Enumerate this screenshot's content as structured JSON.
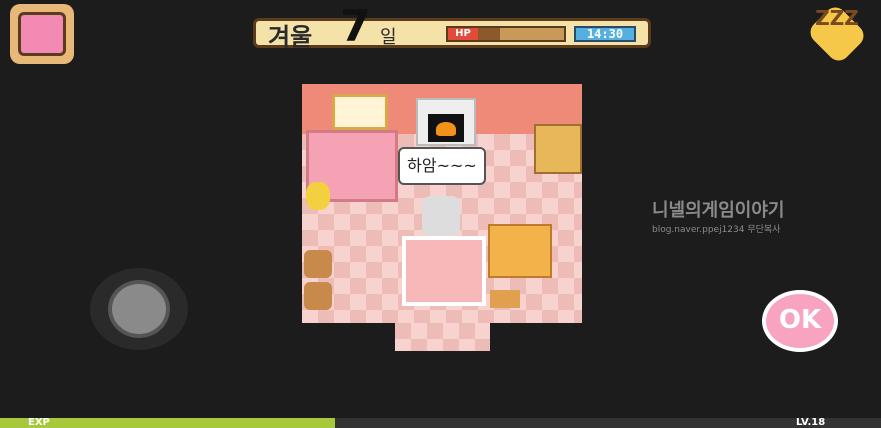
{
  "hud": {
    "season": "겨울",
    "day": "7",
    "day_unit": "일",
    "hp_label": "HP",
    "hp_ratio": 0.25,
    "time": "14:30"
  },
  "dialog": {
    "text": "하암~~~"
  },
  "watermark": {
    "title": "니넬의게임이야기",
    "sub": "blog.naver.ppej1234 무단복사"
  },
  "buttons": {
    "ok_label": "OK",
    "sleep_label": "ZZZ"
  },
  "footer": {
    "exp_label": "EXP",
    "exp_ratio": 0.38,
    "level_label": "LV.18"
  },
  "colors": {
    "hp": "#e24a3a",
    "exp": "#a6c83a",
    "ok": "#f8a4c0",
    "clock": "#55b0e0"
  }
}
